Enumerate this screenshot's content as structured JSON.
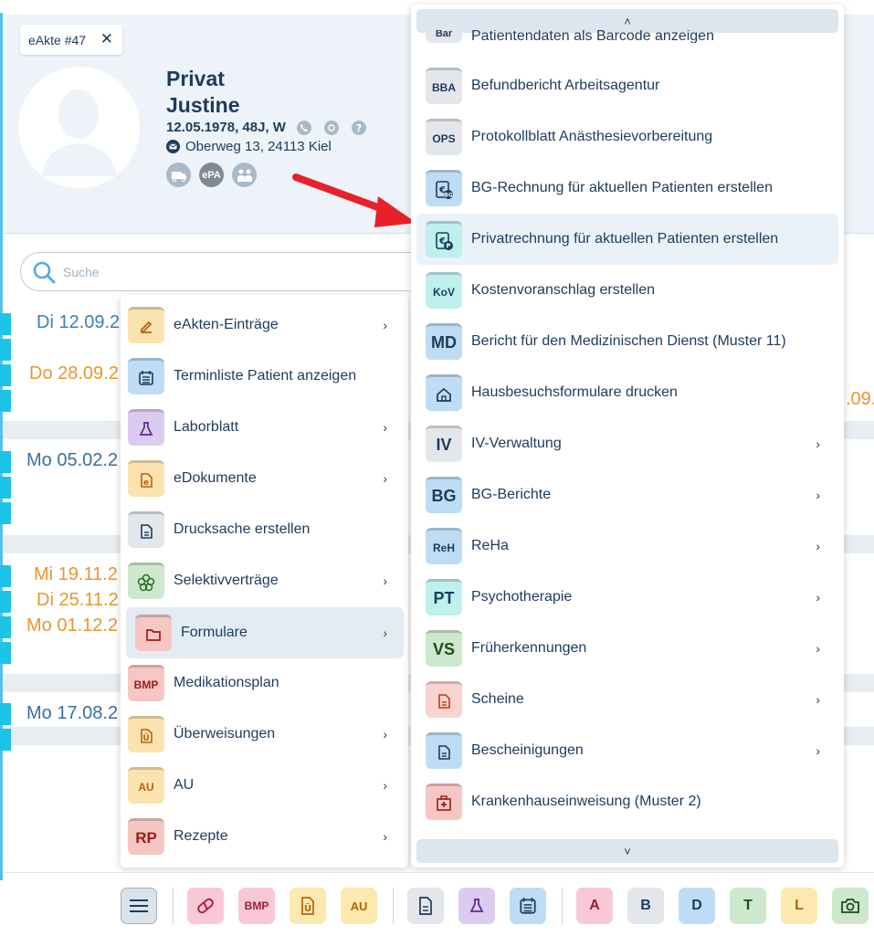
{
  "header": {
    "tab_label": "eAkte #47",
    "tab_close": "✕",
    "name_line1": "Privat",
    "name_line2": "Justine",
    "dob_line": "12.05.1978, 48J, W",
    "address": "Oberweg 13, 24113 Kiel",
    "badge_epa": "ePA"
  },
  "search": {
    "placeholder": "Suche"
  },
  "timeline": {
    "dates": [
      {
        "text": "Di 12.09.2",
        "color": "#3a7fbf"
      },
      {
        "text": "Do 28.09.2",
        "color": "#e8962e"
      },
      {
        "text": "Mo 05.02.2",
        "color": "#3a6f9f"
      },
      {
        "text": "Mi 19.11.2",
        "color": "#e8962e"
      },
      {
        "text": "Di 25.11.2",
        "color": "#e8962e"
      },
      {
        "text": "Mo 01.12.2",
        "color": "#e8962e"
      },
      {
        "text": "Mo 17.08.2",
        "color": "#3a6f9f"
      }
    ],
    "right_fragment": ".09."
  },
  "menu_left": {
    "items": [
      {
        "label": "eAkten-Einträge",
        "has_sub": true
      },
      {
        "label": "Terminliste Patient anzeigen",
        "has_sub": false
      },
      {
        "label": "Laborblatt",
        "has_sub": true
      },
      {
        "label": "eDokumente",
        "has_sub": true
      },
      {
        "label": "Drucksache erstellen",
        "has_sub": false
      },
      {
        "label": "Selektivverträge",
        "has_sub": true
      },
      {
        "label": "Formulare",
        "has_sub": true
      },
      {
        "label": "Medikationsplan",
        "has_sub": false
      },
      {
        "label": "Überweisungen",
        "has_sub": true
      },
      {
        "label": "AU",
        "has_sub": true
      },
      {
        "label": "Rezepte",
        "has_sub": true
      }
    ],
    "icon_texts": {
      "bmp": "BMP",
      "au": "AU",
      "rp": "RP"
    },
    "selected": "Formulare",
    "chevron": "›"
  },
  "menu_right": {
    "scroll_up": "˄",
    "scroll_down": "˅",
    "items": [
      {
        "label": "Patientendaten als Barcode anzeigen",
        "icon_text": "Bar"
      },
      {
        "label": "Befundbericht Arbeitsagentur",
        "icon_text": "BBA"
      },
      {
        "label": "Protokollblatt Anästhesievorbereitung",
        "icon_text": "OPS"
      },
      {
        "label": "BG-Rechnung für aktuellen Patienten erstellen",
        "icon_text": ""
      },
      {
        "label": "Privatrechnung für aktuellen Patienten erstellen",
        "icon_text": ""
      },
      {
        "label": "Kostenvoranschlag erstellen",
        "icon_text": "KoV"
      },
      {
        "label": "Bericht für den Medizinischen Dienst (Muster 11)",
        "icon_text": "MD"
      },
      {
        "label": "Hausbesuchsformulare drucken",
        "icon_text": ""
      },
      {
        "label": "IV-Verwaltung",
        "icon_text": "IV"
      },
      {
        "label": "BG-Berichte",
        "icon_text": "BG"
      },
      {
        "label": "ReHa",
        "icon_text": "ReH"
      },
      {
        "label": "Psychotherapie",
        "icon_text": "PT"
      },
      {
        "label": "Früherkennungen",
        "icon_text": "VS"
      },
      {
        "label": "Scheine",
        "icon_text": ""
      },
      {
        "label": "Bescheinigungen",
        "icon_text": ""
      },
      {
        "label": "Krankenhauseinweisung (Muster 2)",
        "icon_text": ""
      }
    ],
    "highlighted": "Privatrechnung für aktuellen Patienten erstellen"
  },
  "toolbar": {
    "bmp": "BMP",
    "au": "AU",
    "a": "A",
    "b": "B",
    "d": "D",
    "t": "T",
    "l": "L"
  },
  "colors": {
    "accent": "#1bc4e8",
    "text": "#1d3b5c",
    "arrow": "#e8202a",
    "selected_bg": "#e3ebf3"
  }
}
